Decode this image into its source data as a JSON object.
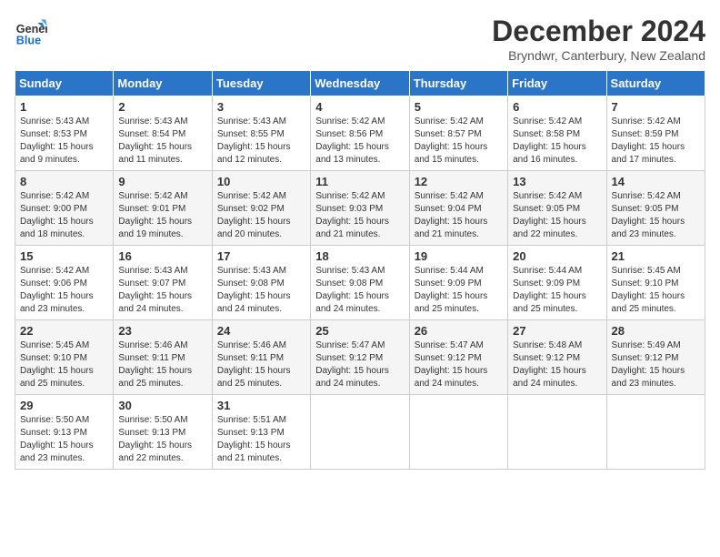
{
  "logo": {
    "line1": "General",
    "line2": "Blue"
  },
  "title": "December 2024",
  "location": "Bryndwr, Canterbury, New Zealand",
  "weekdays": [
    "Sunday",
    "Monday",
    "Tuesday",
    "Wednesday",
    "Thursday",
    "Friday",
    "Saturday"
  ],
  "weeks": [
    [
      {
        "day": "1",
        "info": "Sunrise: 5:43 AM\nSunset: 8:53 PM\nDaylight: 15 hours\nand 9 minutes."
      },
      {
        "day": "2",
        "info": "Sunrise: 5:43 AM\nSunset: 8:54 PM\nDaylight: 15 hours\nand 11 minutes."
      },
      {
        "day": "3",
        "info": "Sunrise: 5:43 AM\nSunset: 8:55 PM\nDaylight: 15 hours\nand 12 minutes."
      },
      {
        "day": "4",
        "info": "Sunrise: 5:42 AM\nSunset: 8:56 PM\nDaylight: 15 hours\nand 13 minutes."
      },
      {
        "day": "5",
        "info": "Sunrise: 5:42 AM\nSunset: 8:57 PM\nDaylight: 15 hours\nand 15 minutes."
      },
      {
        "day": "6",
        "info": "Sunrise: 5:42 AM\nSunset: 8:58 PM\nDaylight: 15 hours\nand 16 minutes."
      },
      {
        "day": "7",
        "info": "Sunrise: 5:42 AM\nSunset: 8:59 PM\nDaylight: 15 hours\nand 17 minutes."
      }
    ],
    [
      {
        "day": "8",
        "info": "Sunrise: 5:42 AM\nSunset: 9:00 PM\nDaylight: 15 hours\nand 18 minutes."
      },
      {
        "day": "9",
        "info": "Sunrise: 5:42 AM\nSunset: 9:01 PM\nDaylight: 15 hours\nand 19 minutes."
      },
      {
        "day": "10",
        "info": "Sunrise: 5:42 AM\nSunset: 9:02 PM\nDaylight: 15 hours\nand 20 minutes."
      },
      {
        "day": "11",
        "info": "Sunrise: 5:42 AM\nSunset: 9:03 PM\nDaylight: 15 hours\nand 21 minutes."
      },
      {
        "day": "12",
        "info": "Sunrise: 5:42 AM\nSunset: 9:04 PM\nDaylight: 15 hours\nand 21 minutes."
      },
      {
        "day": "13",
        "info": "Sunrise: 5:42 AM\nSunset: 9:05 PM\nDaylight: 15 hours\nand 22 minutes."
      },
      {
        "day": "14",
        "info": "Sunrise: 5:42 AM\nSunset: 9:05 PM\nDaylight: 15 hours\nand 23 minutes."
      }
    ],
    [
      {
        "day": "15",
        "info": "Sunrise: 5:42 AM\nSunset: 9:06 PM\nDaylight: 15 hours\nand 23 minutes."
      },
      {
        "day": "16",
        "info": "Sunrise: 5:43 AM\nSunset: 9:07 PM\nDaylight: 15 hours\nand 24 minutes."
      },
      {
        "day": "17",
        "info": "Sunrise: 5:43 AM\nSunset: 9:08 PM\nDaylight: 15 hours\nand 24 minutes."
      },
      {
        "day": "18",
        "info": "Sunrise: 5:43 AM\nSunset: 9:08 PM\nDaylight: 15 hours\nand 24 minutes."
      },
      {
        "day": "19",
        "info": "Sunrise: 5:44 AM\nSunset: 9:09 PM\nDaylight: 15 hours\nand 25 minutes."
      },
      {
        "day": "20",
        "info": "Sunrise: 5:44 AM\nSunset: 9:09 PM\nDaylight: 15 hours\nand 25 minutes."
      },
      {
        "day": "21",
        "info": "Sunrise: 5:45 AM\nSunset: 9:10 PM\nDaylight: 15 hours\nand 25 minutes."
      }
    ],
    [
      {
        "day": "22",
        "info": "Sunrise: 5:45 AM\nSunset: 9:10 PM\nDaylight: 15 hours\nand 25 minutes."
      },
      {
        "day": "23",
        "info": "Sunrise: 5:46 AM\nSunset: 9:11 PM\nDaylight: 15 hours\nand 25 minutes."
      },
      {
        "day": "24",
        "info": "Sunrise: 5:46 AM\nSunset: 9:11 PM\nDaylight: 15 hours\nand 25 minutes."
      },
      {
        "day": "25",
        "info": "Sunrise: 5:47 AM\nSunset: 9:12 PM\nDaylight: 15 hours\nand 24 minutes."
      },
      {
        "day": "26",
        "info": "Sunrise: 5:47 AM\nSunset: 9:12 PM\nDaylight: 15 hours\nand 24 minutes."
      },
      {
        "day": "27",
        "info": "Sunrise: 5:48 AM\nSunset: 9:12 PM\nDaylight: 15 hours\nand 24 minutes."
      },
      {
        "day": "28",
        "info": "Sunrise: 5:49 AM\nSunset: 9:12 PM\nDaylight: 15 hours\nand 23 minutes."
      }
    ],
    [
      {
        "day": "29",
        "info": "Sunrise: 5:50 AM\nSunset: 9:13 PM\nDaylight: 15 hours\nand 23 minutes."
      },
      {
        "day": "30",
        "info": "Sunrise: 5:50 AM\nSunset: 9:13 PM\nDaylight: 15 hours\nand 22 minutes."
      },
      {
        "day": "31",
        "info": "Sunrise: 5:51 AM\nSunset: 9:13 PM\nDaylight: 15 hours\nand 21 minutes."
      },
      {
        "day": "",
        "info": ""
      },
      {
        "day": "",
        "info": ""
      },
      {
        "day": "",
        "info": ""
      },
      {
        "day": "",
        "info": ""
      }
    ]
  ]
}
